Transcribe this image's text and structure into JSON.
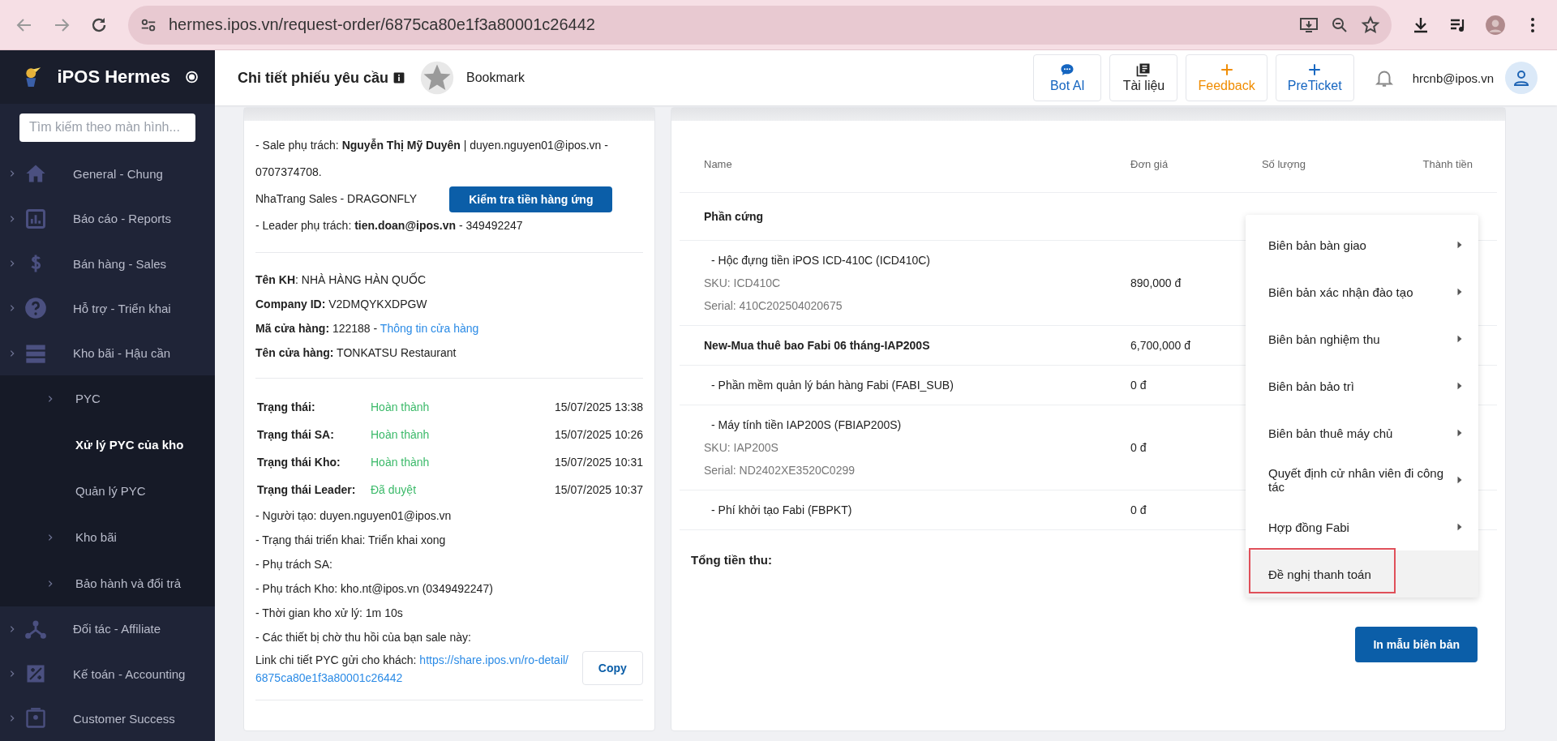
{
  "browser": {
    "url": "hermes.ipos.vn/request-order/6875ca80e1f3a80001c26442"
  },
  "header": {
    "title": "Chi tiết phiếu yêu cầu",
    "bookmark": "Bookmark",
    "actions": [
      {
        "label": "Bot AI",
        "color": "#1565c0"
      },
      {
        "label": "Tài liệu",
        "color": "#222222"
      },
      {
        "label": "Feedback",
        "color": "#f08c00"
      },
      {
        "label": "PreTicket",
        "color": "#1565c0"
      }
    ],
    "user": "hrcnb@ipos.vn"
  },
  "sidebar": {
    "brand": "iPOS Hermes",
    "search": {
      "placeholder": "Tìm kiếm theo màn hình..."
    },
    "items": [
      {
        "label": "General - Chung"
      },
      {
        "label": "Báo cáo - Reports"
      },
      {
        "label": "Bán hàng - Sales"
      },
      {
        "label": "Hỗ trợ - Triển khai"
      },
      {
        "label": "Kho bãi - Hậu cần",
        "children": [
          {
            "label": "PYC",
            "expandable": true,
            "selected": false
          },
          {
            "label": "Xử lý PYC của kho",
            "expandable": false,
            "selected": true
          },
          {
            "label": "Quản lý PYC",
            "expandable": false,
            "selected": false
          },
          {
            "label": "Kho bãi",
            "expandable": true,
            "selected": false
          },
          {
            "label": "Bảo hành và đổi trả",
            "expandable": true,
            "selected": false
          }
        ]
      },
      {
        "label": "Đối tác - Affiliate"
      },
      {
        "label": "Kế toán - Accounting"
      },
      {
        "label": "Customer Success"
      }
    ]
  },
  "info_card": {
    "sale": "- Sale phụ trách: **Nguyễn Thị Mỹ Duyên** | duyen.nguyen01@ipos.vn - 0707374708.",
    "team": "NhaTrang Sales - DRAGONFLY",
    "check_button": "Kiểm tra tiền hàng ứng",
    "leader": "- Leader phụ trách: **tien.doan@ipos.vn** - 349492247",
    "customer": [
      {
        "label": "Tên KH",
        "value": ": NHÀ HÀNG HÀN QUỐC"
      },
      {
        "label": "Company ID:",
        "value": " V2DMQYKXDPGW"
      },
      {
        "label": "Mã cửa hàng:",
        "value": " 122188 - ",
        "link": "Thông tin cửa hàng"
      },
      {
        "label": "Tên cửa hàng:",
        "value": " TONKATSU Restaurant"
      }
    ],
    "statuses": [
      {
        "label": "Trạng thái:",
        "value": "Hoàn thành",
        "time": "15/07/2025 13:38"
      },
      {
        "label": "Trạng thái SA:",
        "value": "Hoàn thành",
        "time": "15/07/2025 10:26"
      },
      {
        "label": "Trạng thái Kho:",
        "value": "Hoàn thành",
        "time": "15/07/2025 10:31"
      },
      {
        "label": "Trạng thái Leader:",
        "value": "Đã duyệt",
        "time": "15/07/2025 10:37"
      }
    ],
    "lines": [
      "- Người tạo: duyen.nguyen01@ipos.vn",
      "- Trạng thái triển khai: Triển khai xong",
      "- Phụ trách SA:",
      "- Phụ trách Kho: kho.nt@ipos.vn (0349492247)",
      "- Thời gian kho xử lý: 1m 10s",
      "- Các thiết bị chờ thu hồi của bạn sale này:"
    ],
    "link_label": "Link chi tiết PYC gửi cho khách: ",
    "link": "https://share.ipos.vn/ro-detail/6875ca80e1f3a80001c26442",
    "copy_button": "Copy"
  },
  "order_table": {
    "columns": [
      "Name",
      "Đơn giá",
      "Số lượng",
      "Thành tiền"
    ],
    "rows": [
      {
        "kind": "group",
        "name": "Phần cứng"
      },
      {
        "kind": "item",
        "name": "- Hộc đựng tiền iPOS ICD-410C (ICD410C)",
        "sku": "SKU: ICD410C",
        "serial": "Serial: 410C202504020675",
        "price": "890,000 đ"
      },
      {
        "kind": "bundle",
        "name": "New-Mua thuê bao Fabi 06 tháng-IAP200S",
        "price": "6,700,000 đ"
      },
      {
        "kind": "item",
        "name": "- Phần mềm quản lý bán hàng Fabi (FABI_SUB)",
        "price": "0 đ"
      },
      {
        "kind": "item",
        "name": "- Máy tính tiền IAP200S (FBIAP200S)",
        "sku": "SKU: IAP200S",
        "serial": "Serial: ND2402XE3520C0299",
        "price": "0 đ"
      },
      {
        "kind": "item",
        "name": "- Phí khởi tạo Fabi (FBPKT)",
        "price": "0 đ"
      }
    ],
    "total_label": "Tổng tiền thu:",
    "print_menu": [
      {
        "label": "Biên bản bàn giao",
        "submenu": true,
        "selected": false
      },
      {
        "label": "Biên bản xác nhận đào tạo",
        "submenu": true,
        "selected": false
      },
      {
        "label": "Biên bản nghiệm thu",
        "submenu": true,
        "selected": false
      },
      {
        "label": "Biên bản bảo trì",
        "submenu": true,
        "selected": false
      },
      {
        "label": "Biên bản thuê máy chủ",
        "submenu": true,
        "selected": false
      },
      {
        "label": "Quyết định cử nhân viên đi công tác",
        "submenu": true,
        "selected": false
      },
      {
        "label": "Hợp đồng Fabi",
        "submenu": true,
        "selected": false
      },
      {
        "label": "Đề nghị thanh toán",
        "submenu": false,
        "selected": true
      }
    ],
    "print_button": "In mẫu biên bản"
  }
}
